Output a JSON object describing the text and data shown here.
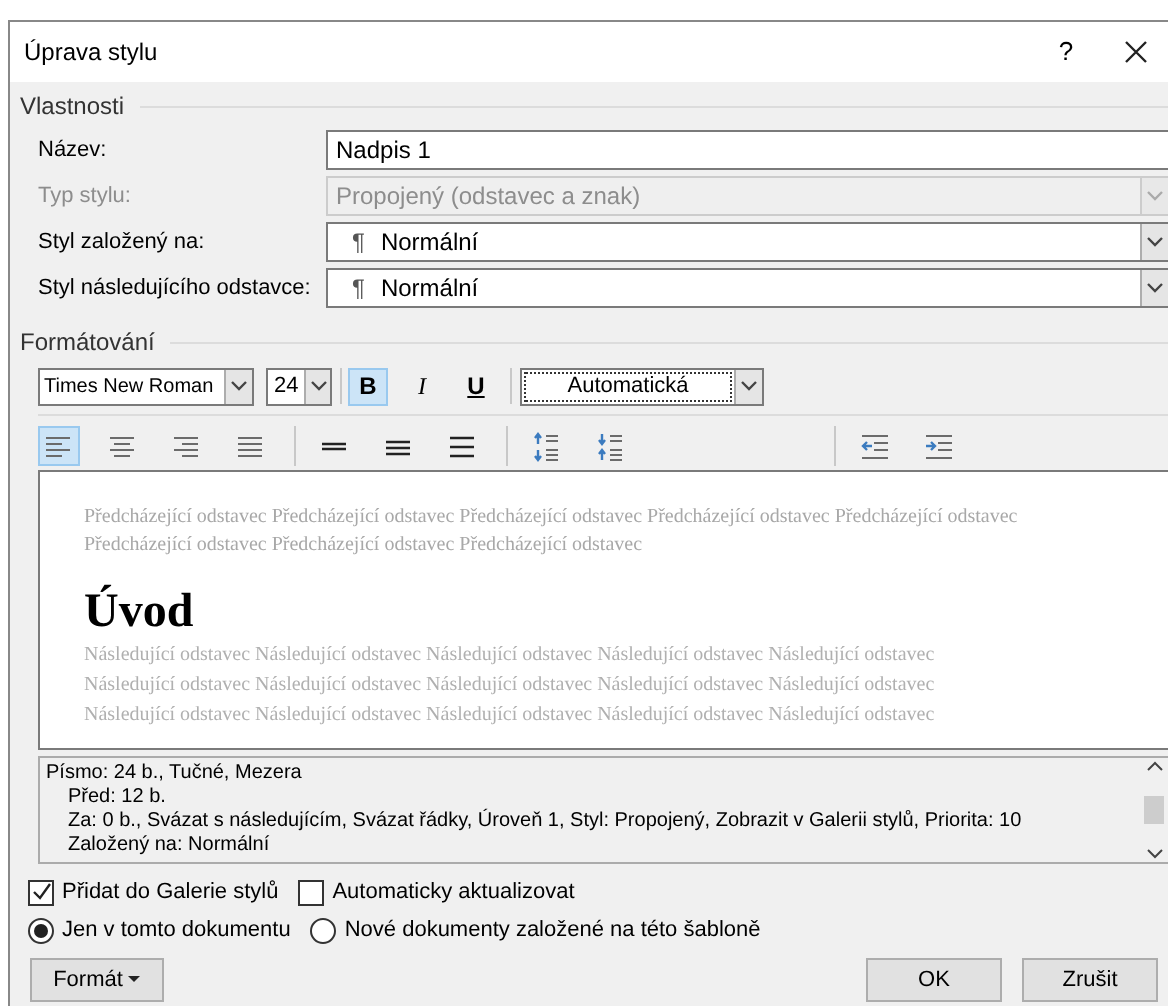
{
  "window": {
    "title": "Úprava stylu",
    "help": "?"
  },
  "properties": {
    "title": "Vlastnosti",
    "fields": [
      {
        "label": "Název:",
        "value": "Nadpis 1",
        "kind": "text",
        "disabled": false
      },
      {
        "label": "Typ stylu:",
        "value": "Propojený (odstavec a znak)",
        "kind": "select",
        "disabled": true
      },
      {
        "label": "Styl založený na:",
        "value": "Normální",
        "mark": "¶",
        "kind": "select",
        "disabled": false
      },
      {
        "label": "Styl následujícího odstavce:",
        "value": "Normální",
        "mark": "¶",
        "kind": "select",
        "disabled": false
      }
    ]
  },
  "formatting": {
    "title": "Formátování",
    "font": "Times New Roman",
    "size": "24",
    "styles": [
      {
        "label": "B",
        "kind": "bold",
        "selected": true
      },
      {
        "label": "I",
        "kind": "italic",
        "selected": false
      },
      {
        "label": "U",
        "kind": "underline",
        "selected": false
      }
    ],
    "color_name": "Automatická",
    "paragraph_buttons": [
      {
        "kind": "align-left",
        "selected": true
      },
      {
        "kind": "align-center",
        "selected": false
      },
      {
        "kind": "align-right",
        "selected": false
      },
      {
        "kind": "justify",
        "selected": false
      },
      {
        "kind": "spacing-single",
        "selected": false
      },
      {
        "kind": "spacing-onehalf",
        "selected": false
      },
      {
        "kind": "spacing-double",
        "selected": false
      },
      {
        "kind": "space-before-more",
        "selected": false
      },
      {
        "kind": "space-before-less",
        "selected": false
      },
      {
        "kind": "indent-less",
        "selected": false
      },
      {
        "kind": "indent-more",
        "selected": false
      }
    ]
  },
  "preview": {
    "preceding_lines": [
      "Předcházející odstavec Předcházející odstavec Předcházející odstavec Předcházející odstavec Předcházející odstavec",
      "Předcházející odstavec Předcházející odstavec Předcházející odstavec"
    ],
    "heading": "Úvod",
    "following_lines": [
      "Následující odstavec Následující odstavec Následující odstavec Následující odstavec Následující odstavec",
      "Následující odstavec Následující odstavec Následující odstavec Následující odstavec Následující odstavec",
      "Následující odstavec Následující odstavec Následující odstavec Následující odstavec Následující odstavec"
    ]
  },
  "description": {
    "first_line": "Písmo: 24 b., Tučné, Mezera",
    "continued_lines": [
      "Před:  12 b.",
      "Za:  0 b., Svázat s následujícím, Svázat řádky, Úroveň 1, Styl: Propojený, Zobrazit v Galerii stylů, Priorita: 10",
      "Založený na: Normální"
    ]
  },
  "options": [
    {
      "label": "Přidat do Galerie stylů",
      "checked": true
    },
    {
      "label": "Automaticky aktualizovat",
      "checked": false
    }
  ],
  "scope": [
    {
      "label": "Jen v tomto dokumentu",
      "selected": true
    },
    {
      "label": "Nové dokumenty založené na této šabloně",
      "selected": false
    }
  ],
  "buttons": {
    "format": "Formát",
    "ok": "OK",
    "cancel": "Zrušit"
  }
}
